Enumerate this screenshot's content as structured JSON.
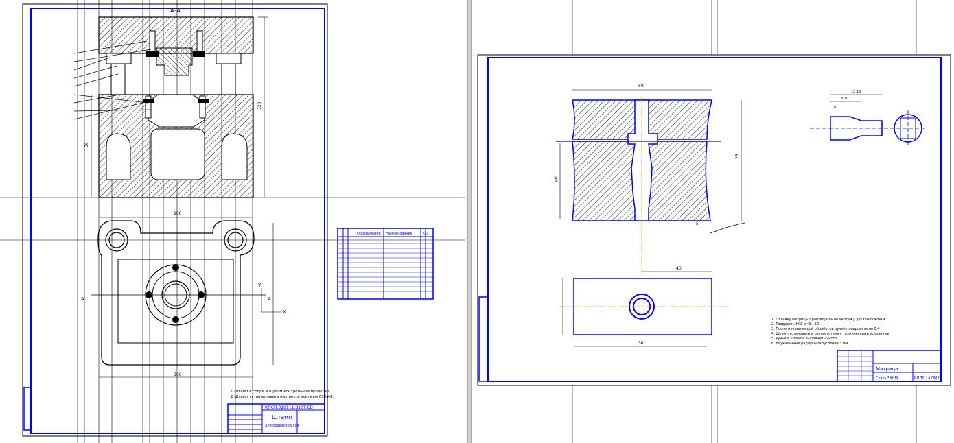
{
  "left_sheet": {
    "section_label": "A–A",
    "cut_label_left": "A",
    "cut_label_right": "A",
    "axis_y": "Y",
    "axis_x": "X",
    "dim_top_width": "280",
    "dim_bottom_width": "300",
    "dim_height_left": "50",
    "dim_height_right": "320",
    "tech_note_1": "1 Штамп в сборе и щупом контрольной проверки.",
    "tech_note_2": "2 Штамп устанавливать на прессе усилием 630 кН.",
    "title_code": "КПСП.310111.В10Т.СБ",
    "title_name": "Штамп",
    "title_sub": "для обрезки облоя",
    "spec_header_1": "Обозначение",
    "spec_header_2": "Наименование",
    "spec_header_3": "Кол."
  },
  "right_sheet": {
    "dim_width": "50",
    "dim_small": "40",
    "dim_len": "25",
    "dim_edge": "5",
    "dim_bottom": "36",
    "dim_detail_1": "12 15",
    "dim_detail_2": "8 10",
    "dim_detail_3": "8",
    "note_1": "1. Отливку матрицы производить по чертежу детали-поковки",
    "note_2": "2. Твердость HRC э 45...50",
    "note_3": "3. После механической обработки ручей полировать по 0.4",
    "note_4": "4. Штамп установить в соответствии с техническими условиями",
    "note_5": "5. Ручьи в штампе выполнить чисто",
    "note_6": "6. Неуказанные радиусы скругления 3 мм",
    "title_code": "КП ТВ.1А.ПМ.01",
    "title_name": "Матрица",
    "title_material": "Сталь 5ХНМ"
  }
}
